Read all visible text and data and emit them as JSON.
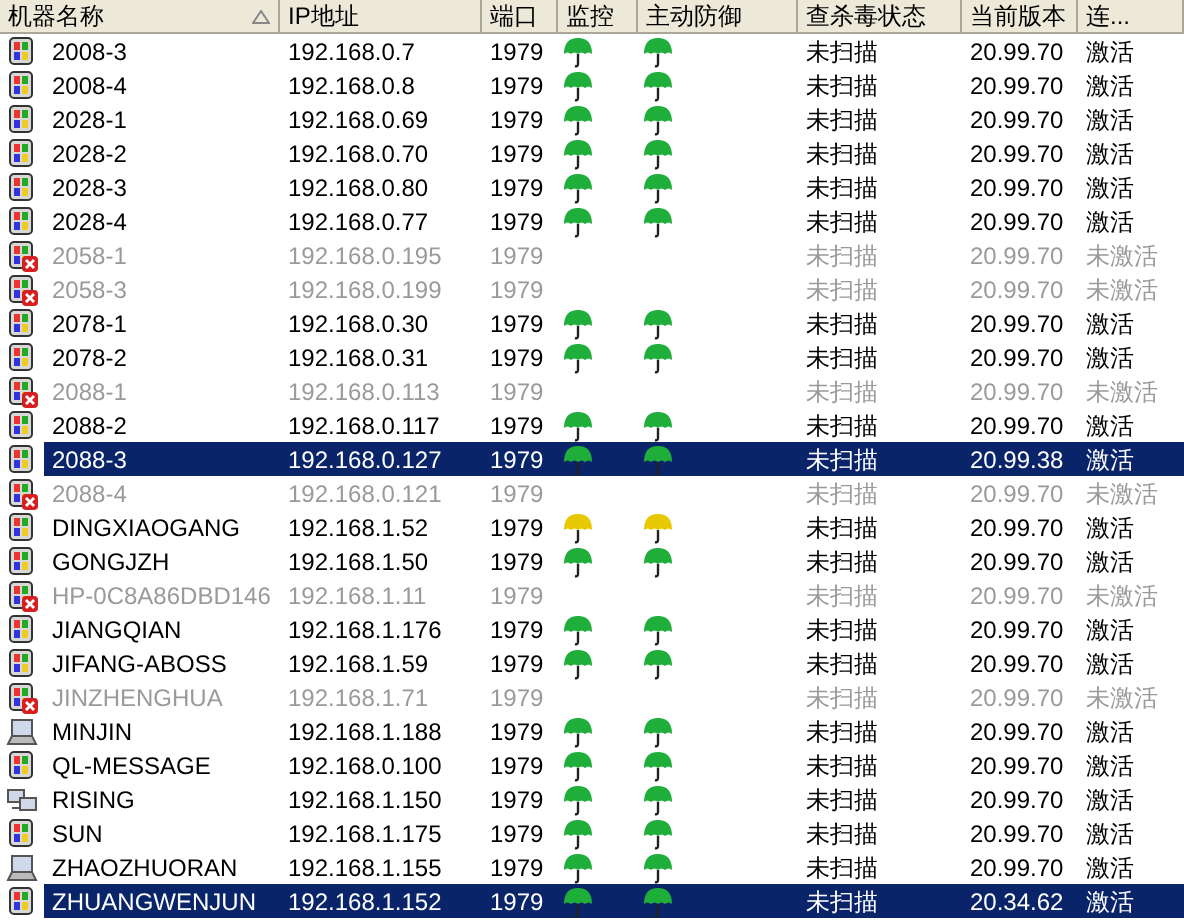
{
  "columns": [
    {
      "label": "机器名称",
      "sorted": true
    },
    {
      "label": "IP地址",
      "sorted": false
    },
    {
      "label": "端口",
      "sorted": false
    },
    {
      "label": "监控",
      "sorted": false
    },
    {
      "label": "主动防御",
      "sorted": false
    },
    {
      "label": "查杀毒状态",
      "sorted": false
    },
    {
      "label": "当前版本",
      "sorted": false
    },
    {
      "label": "连...",
      "sorted": false
    }
  ],
  "rows": [
    {
      "kind": "pc",
      "name": "2008-3",
      "ip": "192.168.0.7",
      "port": "1979",
      "monitor": {
        "color": "#1fae3a"
      },
      "defense": {
        "color": "#1fae3a"
      },
      "status": "未扫描",
      "version": "20.99.70",
      "state": "激活",
      "active": true,
      "selected": false
    },
    {
      "kind": "pc",
      "name": "2008-4",
      "ip": "192.168.0.8",
      "port": "1979",
      "monitor": {
        "color": "#1fae3a"
      },
      "defense": {
        "color": "#1fae3a"
      },
      "status": "未扫描",
      "version": "20.99.70",
      "state": "激活",
      "active": true,
      "selected": false
    },
    {
      "kind": "pc",
      "name": "2028-1",
      "ip": "192.168.0.69",
      "port": "1979",
      "monitor": {
        "color": "#1fae3a"
      },
      "defense": {
        "color": "#1fae3a"
      },
      "status": "未扫描",
      "version": "20.99.70",
      "state": "激活",
      "active": true,
      "selected": false
    },
    {
      "kind": "pc",
      "name": "2028-2",
      "ip": "192.168.0.70",
      "port": "1979",
      "monitor": {
        "color": "#1fae3a"
      },
      "defense": {
        "color": "#1fae3a"
      },
      "status": "未扫描",
      "version": "20.99.70",
      "state": "激活",
      "active": true,
      "selected": false
    },
    {
      "kind": "pc",
      "name": "2028-3",
      "ip": "192.168.0.80",
      "port": "1979",
      "monitor": {
        "color": "#1fae3a"
      },
      "defense": {
        "color": "#1fae3a"
      },
      "status": "未扫描",
      "version": "20.99.70",
      "state": "激活",
      "active": true,
      "selected": false
    },
    {
      "kind": "pc",
      "name": "2028-4",
      "ip": "192.168.0.77",
      "port": "1979",
      "monitor": {
        "color": "#1fae3a"
      },
      "defense": {
        "color": "#1fae3a"
      },
      "status": "未扫描",
      "version": "20.99.70",
      "state": "激活",
      "active": true,
      "selected": false
    },
    {
      "kind": "pc",
      "name": "2058-1",
      "ip": "192.168.0.195",
      "port": "1979",
      "status": "未扫描",
      "version": "20.99.70",
      "state": "未激活",
      "active": false,
      "selected": false
    },
    {
      "kind": "pc",
      "name": "2058-3",
      "ip": "192.168.0.199",
      "port": "1979",
      "status": "未扫描",
      "version": "20.99.70",
      "state": "未激活",
      "active": false,
      "selected": false
    },
    {
      "kind": "pc",
      "name": "2078-1",
      "ip": "192.168.0.30",
      "port": "1979",
      "monitor": {
        "color": "#1fae3a"
      },
      "defense": {
        "color": "#1fae3a"
      },
      "status": "未扫描",
      "version": "20.99.70",
      "state": "激活",
      "active": true,
      "selected": false
    },
    {
      "kind": "pc",
      "name": "2078-2",
      "ip": "192.168.0.31",
      "port": "1979",
      "monitor": {
        "color": "#1fae3a"
      },
      "defense": {
        "color": "#1fae3a"
      },
      "status": "未扫描",
      "version": "20.99.70",
      "state": "激活",
      "active": true,
      "selected": false
    },
    {
      "kind": "pc",
      "name": "2088-1",
      "ip": "192.168.0.113",
      "port": "1979",
      "status": "未扫描",
      "version": "20.99.70",
      "state": "未激活",
      "active": false,
      "selected": false
    },
    {
      "kind": "pc",
      "name": "2088-2",
      "ip": "192.168.0.117",
      "port": "1979",
      "monitor": {
        "color": "#1fae3a"
      },
      "defense": {
        "color": "#1fae3a"
      },
      "status": "未扫描",
      "version": "20.99.70",
      "state": "激活",
      "active": true,
      "selected": false
    },
    {
      "kind": "pc",
      "name": "2088-3",
      "ip": "192.168.0.127",
      "port": "1979",
      "monitor": {
        "color": "#1fae3a"
      },
      "defense": {
        "color": "#1fae3a"
      },
      "status": "未扫描",
      "version": "20.99.38",
      "state": "激活",
      "active": true,
      "selected": true
    },
    {
      "kind": "pc",
      "name": "2088-4",
      "ip": "192.168.0.121",
      "port": "1979",
      "status": "未扫描",
      "version": "20.99.70",
      "state": "未激活",
      "active": false,
      "selected": false
    },
    {
      "kind": "pc",
      "name": "DINGXIAOGANG",
      "ip": "192.168.1.52",
      "port": "1979",
      "monitor": {
        "color": "#e8c800"
      },
      "defense": {
        "color": "#e8c800"
      },
      "status": "未扫描",
      "version": "20.99.70",
      "state": "激活",
      "active": true,
      "selected": false
    },
    {
      "kind": "pc",
      "name": "GONGJZH",
      "ip": "192.168.1.50",
      "port": "1979",
      "monitor": {
        "color": "#1fae3a"
      },
      "defense": {
        "color": "#1fae3a"
      },
      "status": "未扫描",
      "version": "20.99.70",
      "state": "激活",
      "active": true,
      "selected": false
    },
    {
      "kind": "pc",
      "name": "HP-0C8A86DBD146",
      "ip": "192.168.1.11",
      "port": "1979",
      "status": "未扫描",
      "version": "20.99.70",
      "state": "未激活",
      "active": false,
      "selected": false
    },
    {
      "kind": "pc",
      "name": "JIANGQIAN",
      "ip": "192.168.1.176",
      "port": "1979",
      "monitor": {
        "color": "#1fae3a"
      },
      "defense": {
        "color": "#1fae3a"
      },
      "status": "未扫描",
      "version": "20.99.70",
      "state": "激活",
      "active": true,
      "selected": false
    },
    {
      "kind": "pc",
      "name": "JIFANG-ABOSS",
      "ip": "192.168.1.59",
      "port": "1979",
      "monitor": {
        "color": "#1fae3a"
      },
      "defense": {
        "color": "#1fae3a"
      },
      "status": "未扫描",
      "version": "20.99.70",
      "state": "激活",
      "active": true,
      "selected": false
    },
    {
      "kind": "pc",
      "name": "JINZHENGHUA",
      "ip": "192.168.1.71",
      "port": "1979",
      "status": "未扫描",
      "version": "20.99.70",
      "state": "未激活",
      "active": false,
      "selected": false
    },
    {
      "kind": "laptop",
      "name": "MINJIN",
      "ip": "192.168.1.188",
      "port": "1979",
      "monitor": {
        "color": "#1fae3a"
      },
      "defense": {
        "color": "#1fae3a"
      },
      "status": "未扫描",
      "version": "20.99.70",
      "state": "激活",
      "active": true,
      "selected": false
    },
    {
      "kind": "pc",
      "name": "QL-MESSAGE",
      "ip": "192.168.0.100",
      "port": "1979",
      "monitor": {
        "color": "#1fae3a"
      },
      "defense": {
        "color": "#1fae3a"
      },
      "status": "未扫描",
      "version": "20.99.70",
      "state": "激活",
      "active": true,
      "selected": false
    },
    {
      "kind": "network",
      "name": "RISING",
      "ip": "192.168.1.150",
      "port": "1979",
      "monitor": {
        "color": "#1fae3a"
      },
      "defense": {
        "color": "#1fae3a"
      },
      "status": "未扫描",
      "version": "20.99.70",
      "state": "激活",
      "active": true,
      "selected": false
    },
    {
      "kind": "pc",
      "name": "SUN",
      "ip": "192.168.1.175",
      "port": "1979",
      "monitor": {
        "color": "#1fae3a"
      },
      "defense": {
        "color": "#1fae3a"
      },
      "status": "未扫描",
      "version": "20.99.70",
      "state": "激活",
      "active": true,
      "selected": false
    },
    {
      "kind": "laptop",
      "name": "ZHAOZHUORAN",
      "ip": "192.168.1.155",
      "port": "1979",
      "monitor": {
        "color": "#1fae3a"
      },
      "defense": {
        "color": "#1fae3a"
      },
      "status": "未扫描",
      "version": "20.99.70",
      "state": "激活",
      "active": true,
      "selected": false
    },
    {
      "kind": "pc",
      "name": "ZHUANGWENJUN",
      "ip": "192.168.1.152",
      "port": "1979",
      "monitor": {
        "color": "#1fae3a"
      },
      "defense": {
        "color": "#1fae3a"
      },
      "status": "未扫描",
      "version": "20.34.62",
      "state": "激活",
      "active": true,
      "selected": true
    }
  ]
}
